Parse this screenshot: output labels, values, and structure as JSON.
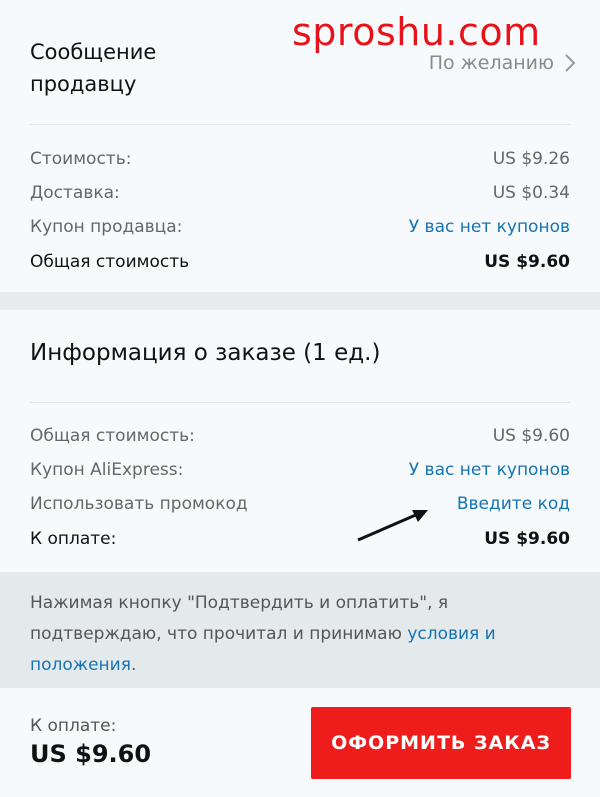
{
  "watermark": "sproshu.com",
  "seller_message": {
    "title": "Сообщение продавцу",
    "value": "По желанию"
  },
  "summary": {
    "rows": [
      {
        "label": "Стоимость:",
        "value": "US $9.26"
      },
      {
        "label": "Доставка:",
        "value": "US $0.34"
      },
      {
        "label": "Купон продавца:",
        "value": "У вас нет купонов"
      }
    ],
    "total_label": "Общая стоимость",
    "total_value": "US $9.60"
  },
  "order_info": {
    "title": "Информация о заказе (1 ед.)",
    "rows": [
      {
        "label": "Общая стоимость:",
        "value": "US $9.60"
      },
      {
        "label": "Купон AliExpress:",
        "value": "У вас нет купонов"
      },
      {
        "label": "Использовать промокод",
        "value": "Введите код"
      }
    ],
    "pay_label": "К оплате:",
    "pay_value": "US $9.60"
  },
  "agreement": {
    "text": "Нажимая кнопку \"Подтвердить и оплатить\", я подтверждаю, что прочитал и принимаю ",
    "link": "условия и положения",
    "end": "."
  },
  "bottom_bar": {
    "pay_label": "К оплате:",
    "pay_amount": "US $9.60",
    "button_label": "ОФОРМИТЬ ЗАКАЗ"
  },
  "colors": {
    "link": "#1673b2",
    "button": "#ef1c1c",
    "watermark": "#e8131a"
  }
}
